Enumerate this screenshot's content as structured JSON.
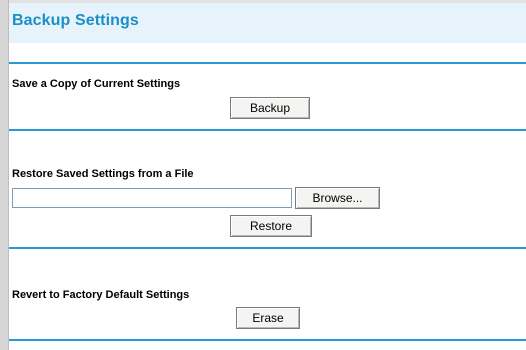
{
  "page": {
    "title": "Backup Settings"
  },
  "backup": {
    "label": "Save a Copy of Current Settings",
    "button_label": "Backup"
  },
  "restore": {
    "label": "Restore Saved Settings from a File",
    "file_value": "",
    "browse_label": "Browse...",
    "button_label": "Restore"
  },
  "factory": {
    "label": "Revert to Factory Default Settings",
    "button_label": "Erase"
  },
  "colors": {
    "title": "#1a8fc8",
    "divider": "#2a9ad3",
    "title_band": "#e6f3fb"
  }
}
